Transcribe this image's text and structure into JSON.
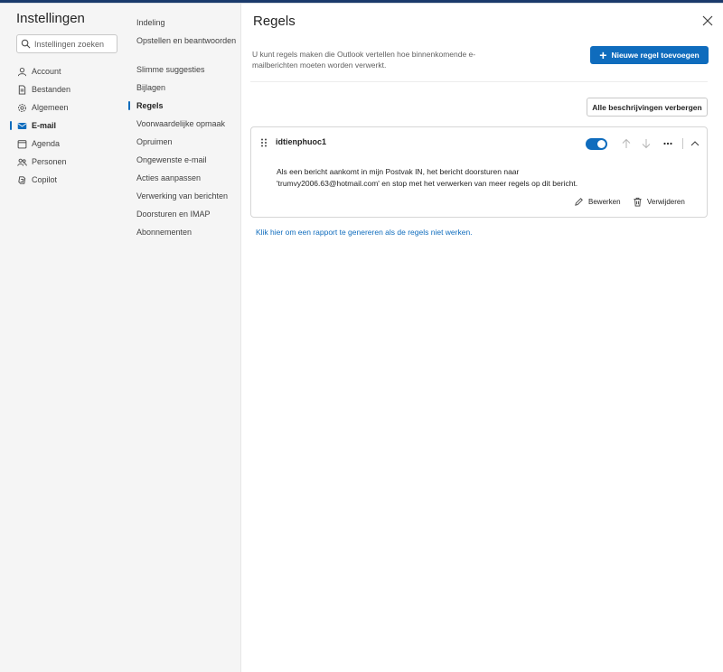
{
  "settings": {
    "title": "Instellingen",
    "search_placeholder": "Instellingen zoeken",
    "nav": [
      {
        "label": "Account",
        "icon": "person-icon"
      },
      {
        "label": "Bestanden",
        "icon": "document-icon"
      },
      {
        "label": "Algemeen",
        "icon": "gear-icon"
      },
      {
        "label": "E-mail",
        "icon": "mail-icon",
        "active": true
      },
      {
        "label": "Agenda",
        "icon": "calendar-icon"
      },
      {
        "label": "Personen",
        "icon": "people-icon"
      },
      {
        "label": "Copilot",
        "icon": "copilot-icon"
      }
    ]
  },
  "mail_nav": [
    "Indeling",
    "Opstellen en beantwoorden",
    "Slimme suggesties",
    "Bijlagen",
    "Regels",
    "Voorwaardelijke opmaak",
    "Opruimen",
    "Ongewenste e-mail",
    "Acties aanpassen",
    "Verwerking van berichten",
    "Doorsturen en IMAP",
    "Abonnementen"
  ],
  "mail_nav_active": "Regels",
  "main": {
    "title": "Regels",
    "description": "U kunt regels maken die Outlook vertellen hoe binnenkomende e-mailberichten moeten worden verwerkt.",
    "new_rule_label": "Nieuwe regel toevoegen",
    "hide_descriptions_label": "Alle beschrijvingen verbergen",
    "rule": {
      "name": "idtienphuoc1",
      "enabled": true,
      "description": "Als een bericht aankomt in mijn Postvak IN, het bericht doorsturen naar 'trumvy2006.63@hotmail.com' en stop met het verwerken van meer regels op dit bericht.",
      "edit_label": "Bewerken",
      "delete_label": "Verwijderen"
    },
    "report_link": "Klik hier om een rapport te genereren als de regels niet werken."
  },
  "colors": {
    "accent": "#0f6cbd",
    "nav_background": "#f5f5f5",
    "backdrop": "#b9b9b9"
  }
}
